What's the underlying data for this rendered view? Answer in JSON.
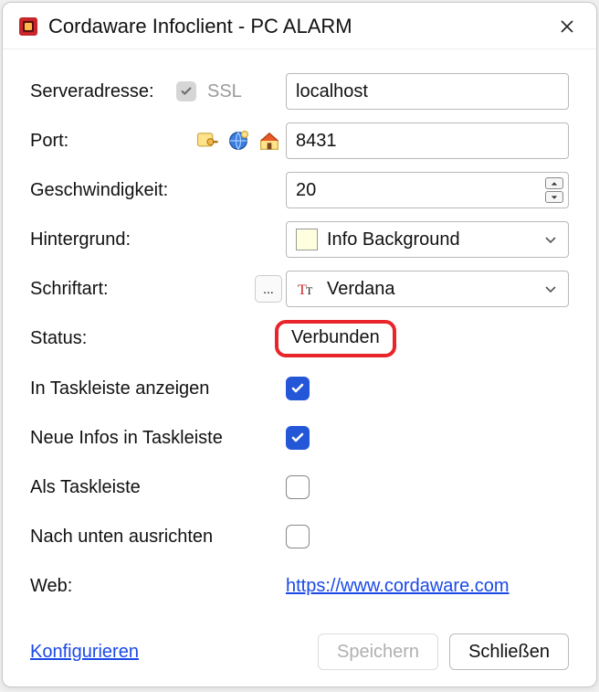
{
  "window": {
    "title": "Cordaware Infoclient - PC ALARM"
  },
  "labels": {
    "server": "Serveradresse:",
    "ssl": "SSL",
    "port": "Port:",
    "speed": "Geschwindigkeit:",
    "background": "Hintergrund:",
    "font": "Schriftart:",
    "status": "Status:",
    "showTaskbar": "In Taskleiste anzeigen",
    "newInfoTaskbar": "Neue Infos in Taskleiste",
    "asTaskbar": "Als Taskleiste",
    "alignBottom": "Nach unten ausrichten",
    "web": "Web:"
  },
  "values": {
    "server": "localhost",
    "port": "8431",
    "speed": "20",
    "backgroundName": "Info Background",
    "backgroundColor": "#ffffe0",
    "fontName": "Verdana",
    "status": "Verbunden",
    "showTaskbar": true,
    "newInfoTaskbar": true,
    "asTaskbar": false,
    "alignBottom": false,
    "webUrl": "https://www.cordaware.com"
  },
  "buttons": {
    "ellipsis": "...",
    "configure": "Konfigurieren",
    "save": "Speichern",
    "close": "Schließen"
  },
  "icons": {
    "app": "app-icon",
    "close": "close-icon",
    "key": "key-icon",
    "globe": "globe-icon",
    "home": "home-icon",
    "font": "font-icon"
  }
}
